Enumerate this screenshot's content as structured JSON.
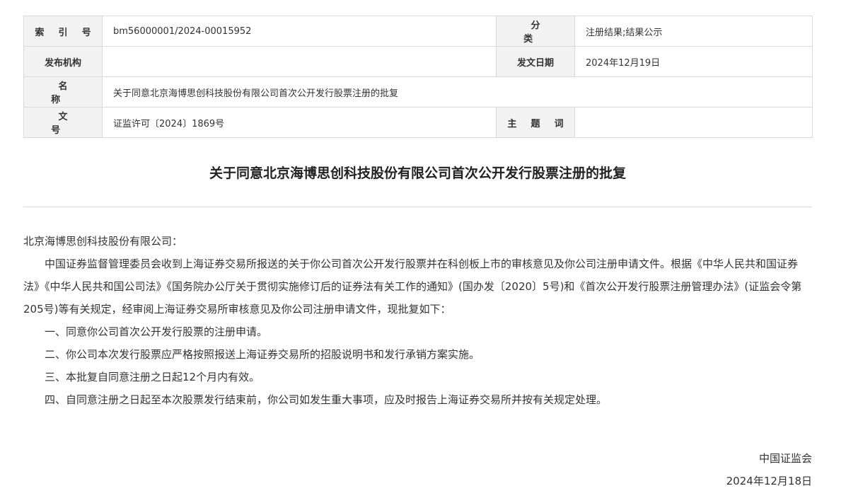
{
  "meta": {
    "index_label": "索 引 号",
    "index_value": "bm56000001/2024-00015952",
    "category_label": "分 类",
    "category_value": "注册结果;结果公示",
    "publisher_label": "发布机构",
    "publisher_value": "",
    "date_label": "发文日期",
    "date_value": "2024年12月19日",
    "name_label": "名 称",
    "name_value": "关于同意北京海博思创科技股份有限公司首次公开发行股票注册的批复",
    "docnum_label": "文 号",
    "docnum_value": "证监许可〔2024〕1869号",
    "keyword_label": "主 题 词",
    "keyword_value": ""
  },
  "document": {
    "title": "关于同意北京海博思创科技股份有限公司首次公开发行股票注册的批复",
    "salutation": "北京海博思创科技股份有限公司：",
    "intro": "中国证券监督管理委员会收到上海证券交易所报送的关于你公司首次公开发行股票并在科创板上市的审核意见及你公司注册申请文件。根据《中华人民共和国证券法》《中华人民共和国公司法》《国务院办公厅关于贯彻实施修订后的证券法有关工作的通知》(国办发〔2020〕5号)和《首次公开发行股票注册管理办法》(证监会令第205号)等有关规定，经审阅上海证券交易所审核意见及你公司注册申请文件，现批复如下：",
    "items": [
      "一、同意你公司首次公开发行股票的注册申请。",
      "二、你公司本次发行股票应严格按照报送上海证券交易所的招股说明书和发行承销方案实施。",
      "三、本批复自同意注册之日起12个月内有效。",
      "四、自同意注册之日起至本次股票发行结束前，你公司如发生重大事项，应及时报告上海证券交易所并按有关规定处理。"
    ],
    "signer": "中国证监会",
    "sign_date": "2024年12月18日"
  }
}
